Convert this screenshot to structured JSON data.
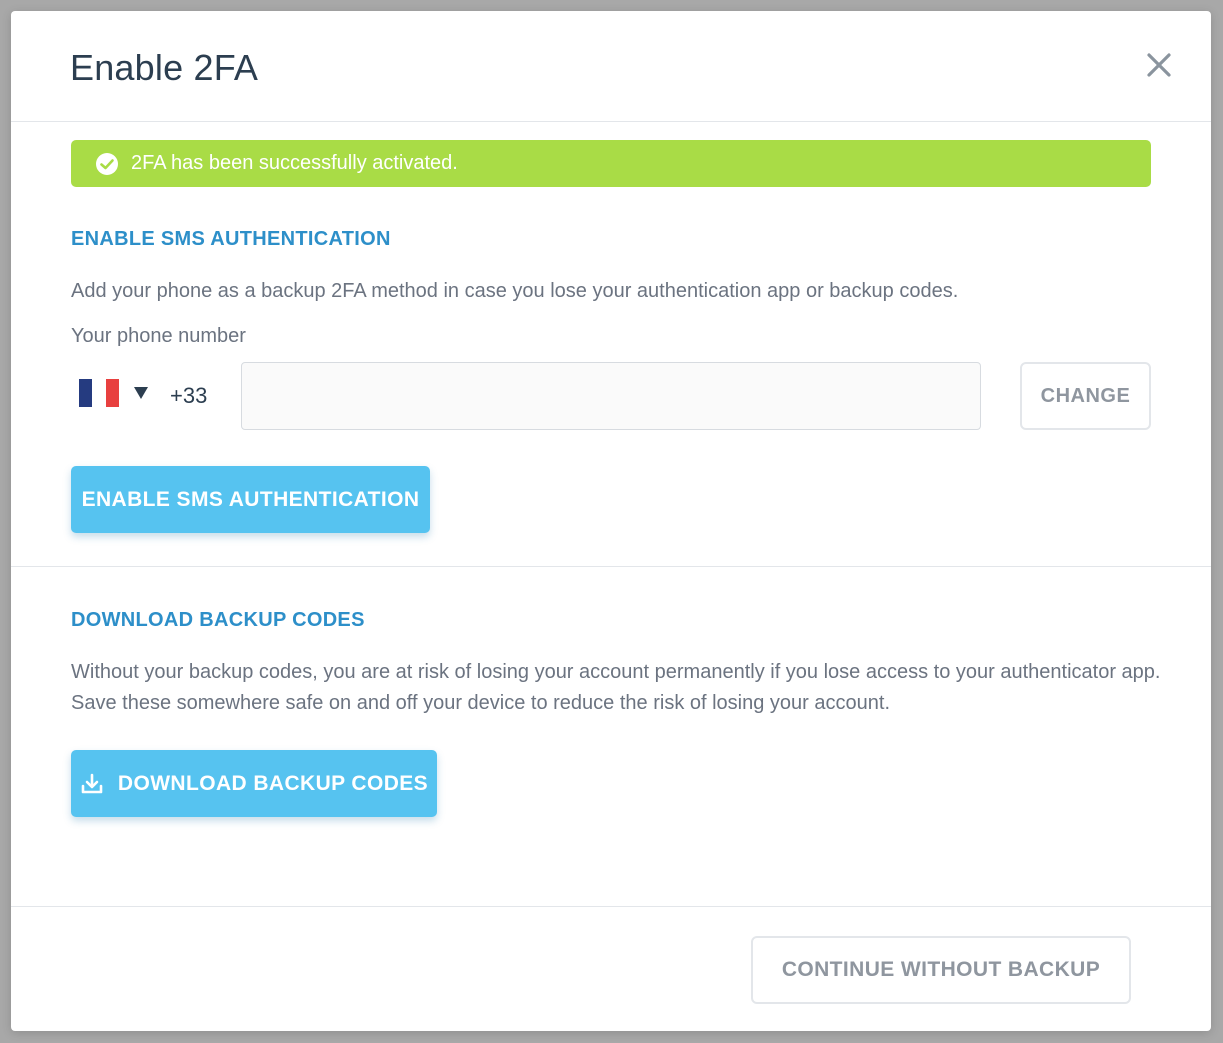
{
  "modal": {
    "title": "Enable 2FA"
  },
  "alert": {
    "message": "2FA has been successfully activated.",
    "color": "#a9dc46"
  },
  "sms": {
    "heading": "ENABLE SMS AUTHENTICATION",
    "description": "Add your phone as a backup 2FA method in case you lose your authentication app or backup codes.",
    "phone_label": "Your phone number",
    "country_flag": "flag-france-icon",
    "dial_code": "+33",
    "phone_value": "",
    "change_label": "CHANGE",
    "enable_label": "ENABLE SMS AUTHENTICATION"
  },
  "backup": {
    "heading": "DOWNLOAD BACKUP CODES",
    "description": "Without your backup codes, you are at risk of losing your account permanently if you lose access to your authenticator app. Save these somewhere safe on and off your device to reduce the risk of losing your account.",
    "download_label": "DOWNLOAD BACKUP CODES"
  },
  "footer": {
    "continue_label": "CONTINUE WITHOUT BACKUP"
  },
  "colors": {
    "accent_button": "#56c3f0",
    "heading": "#2d8fc9",
    "title": "#2c3e50"
  }
}
